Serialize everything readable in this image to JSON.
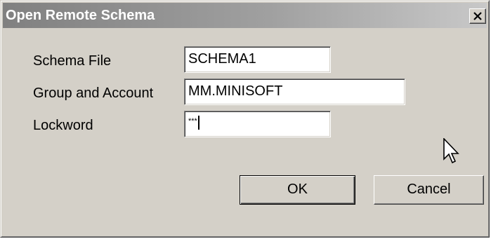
{
  "window": {
    "title": "Open Remote Schema",
    "close_icon": "close-icon"
  },
  "form": {
    "schema_file": {
      "label": "Schema File",
      "value": "SCHEMA1"
    },
    "group_account": {
      "label": "Group and Account",
      "value": "MM.MINISOFT"
    },
    "lockword": {
      "label": "Lockword",
      "value": "***"
    }
  },
  "buttons": {
    "ok_label": "OK",
    "cancel_label": "Cancel"
  },
  "colors": {
    "dialog_face": "#d4d0c8",
    "titlebar_start": "#808080",
    "titlebar_end": "#c8c8c8",
    "title_text": "#ffffff"
  },
  "icons": {
    "pointer": "mouse-pointer-icon"
  }
}
